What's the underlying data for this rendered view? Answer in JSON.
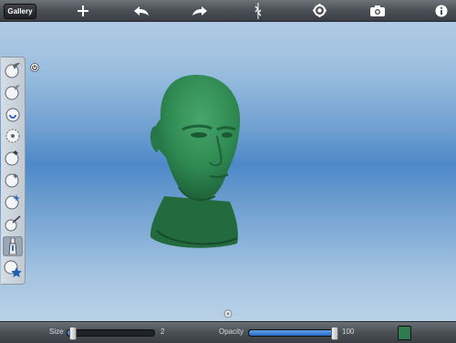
{
  "toolbar": {
    "gallery_label": "Gallery",
    "icons": [
      "plus-icon",
      "undo-icon",
      "redo-icon",
      "symmetry-icon",
      "settings-icon",
      "camera-icon",
      "info-icon"
    ]
  },
  "palette": {
    "tools": [
      "draw-tool-icon",
      "smooth-tool-icon",
      "grab-tool-icon",
      "pinch-tool-icon",
      "flatten-tool-icon",
      "inflate-tool-icon",
      "layer-tool-icon",
      "crease-tool-icon",
      "paint-tool-icon",
      "mask-tool-icon"
    ],
    "active_index": 8
  },
  "bottombar": {
    "size_label": "Size",
    "size_value": "2",
    "size_fraction": 0.02,
    "opacity_label": "Opacity",
    "opacity_value": "100",
    "opacity_fraction": 1.0
  },
  "colors": {
    "paint_color": "#2e7b4e",
    "model_color": "#2f8a52",
    "accent": "#3b7ad1"
  }
}
